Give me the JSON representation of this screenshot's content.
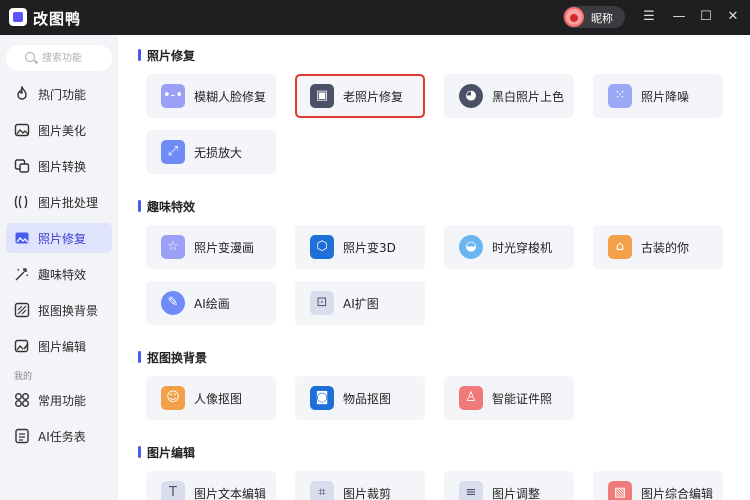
{
  "app": {
    "title": "改图鸭",
    "user_name": "昵称"
  },
  "sidebar": {
    "search_placeholder": "搜索功能",
    "items": [
      {
        "label": "热门功能",
        "icon": "flame-icon"
      },
      {
        "label": "图片美化",
        "icon": "image-beautify-icon"
      },
      {
        "label": "图片转换",
        "icon": "convert-icon"
      },
      {
        "label": "图片批处理",
        "icon": "batch-icon"
      },
      {
        "label": "照片修复",
        "icon": "photo-repair-icon"
      },
      {
        "label": "趣味特效",
        "icon": "magic-wand-icon"
      },
      {
        "label": "抠图换背景",
        "icon": "cutout-icon"
      },
      {
        "label": "图片编辑",
        "icon": "image-edit-icon"
      }
    ],
    "section_mine": "我的",
    "mine_items": [
      {
        "label": "常用功能",
        "icon": "grid-icon"
      },
      {
        "label": "AI任务表",
        "icon": "task-list-icon"
      }
    ],
    "active_index": 4
  },
  "main": {
    "sections": [
      {
        "title": "照片修复",
        "cards": [
          "模糊人脸修复",
          "老照片修复",
          "黑白照片上色",
          "照片降噪",
          "无损放大"
        ]
      },
      {
        "title": "趣味特效",
        "cards": [
          "照片变漫画",
          "照片变3D",
          "时光穿梭机",
          "古装的你",
          "AI绘画",
          "AI扩图"
        ]
      },
      {
        "title": "抠图换背景",
        "cards": [
          "人像抠图",
          "物品抠图",
          "智能证件照"
        ]
      },
      {
        "title": "图片编辑",
        "cards": [
          "图片文本编辑",
          "图片裁剪",
          "图片调整",
          "图片综合编辑"
        ]
      }
    ],
    "highlighted_card": "老照片修复"
  },
  "colors": {
    "accent": "#4a5cf0",
    "highlight_border": "#e0382b",
    "titlebar": "#1f1f22"
  }
}
